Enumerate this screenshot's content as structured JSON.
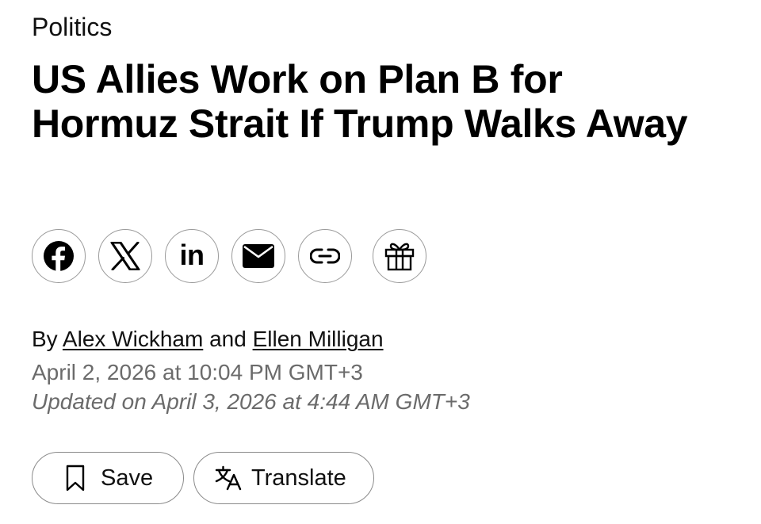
{
  "article": {
    "section": "Politics",
    "headline": "US Allies Work on Plan B for Hormuz Strait If Trump Walks Away",
    "byline": {
      "prefix": "By",
      "author1": "Alex Wickham",
      "conjunction": "and",
      "author2": "Ellen Milligan"
    },
    "published": "April 2, 2026 at 10:04 PM GMT+3",
    "updated": "Updated on April 3, 2026 at 4:44 AM GMT+3"
  },
  "share": {
    "buttons": [
      {
        "icon": "facebook-icon"
      },
      {
        "icon": "x-icon"
      },
      {
        "icon": "linkedin-icon",
        "label": "in"
      },
      {
        "icon": "mail-icon"
      },
      {
        "icon": "link-icon"
      },
      {
        "icon": "gift-icon"
      }
    ]
  },
  "actions": {
    "save_label": "Save",
    "save_icon": "bookmark-icon",
    "translate_label": "Translate",
    "translate_icon": "translate-icon"
  },
  "colors": {
    "text": "#000000",
    "meta_text": "#6b6b6b",
    "border": "#9a9a9a"
  }
}
